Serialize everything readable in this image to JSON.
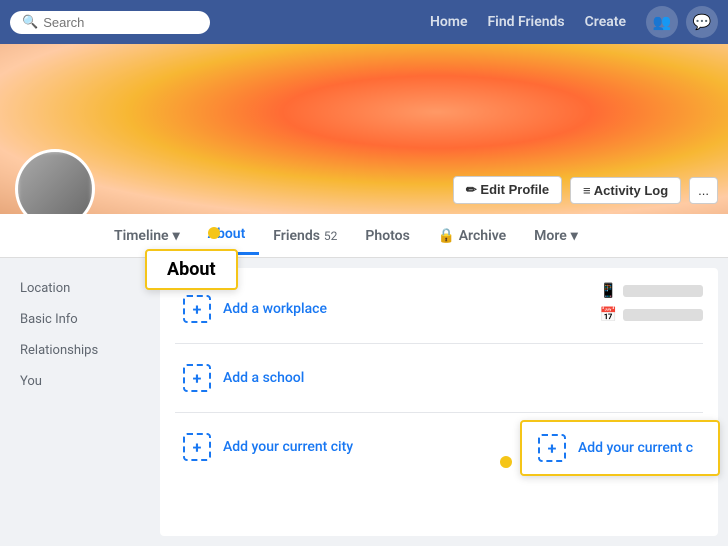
{
  "nav": {
    "search_placeholder": "Search",
    "links": [
      "Home",
      "Find Friends",
      "Create"
    ],
    "icons": [
      "👥",
      "💬"
    ]
  },
  "profile": {
    "edit_profile_label": "✏ Edit Profile",
    "activity_log_label": "≡ Activity Log",
    "more_options_label": "..."
  },
  "tabs": [
    {
      "id": "timeline",
      "label": "Timeline",
      "has_arrow": true
    },
    {
      "id": "about",
      "label": "About",
      "active": true
    },
    {
      "id": "friends",
      "label": "Friends",
      "badge": "52"
    },
    {
      "id": "photos",
      "label": "Photos"
    },
    {
      "id": "archive",
      "label": "🔒 Archive"
    },
    {
      "id": "more",
      "label": "More",
      "has_arrow": true
    }
  ],
  "about_callout": {
    "label": "About"
  },
  "sidebar": {
    "items": [
      {
        "id": "location",
        "label": "Location"
      },
      {
        "id": "basic-info",
        "label": "Basic Info"
      },
      {
        "id": "relationships",
        "label": "Relationships"
      },
      {
        "id": "you",
        "label": "You"
      }
    ]
  },
  "main": {
    "add_items": [
      {
        "id": "workplace",
        "label": "Add a workplace"
      },
      {
        "id": "school",
        "label": "Add a school"
      },
      {
        "id": "city",
        "label": "Add your current city"
      }
    ],
    "floating_label": "Add your current c",
    "add_plus": "+"
  }
}
